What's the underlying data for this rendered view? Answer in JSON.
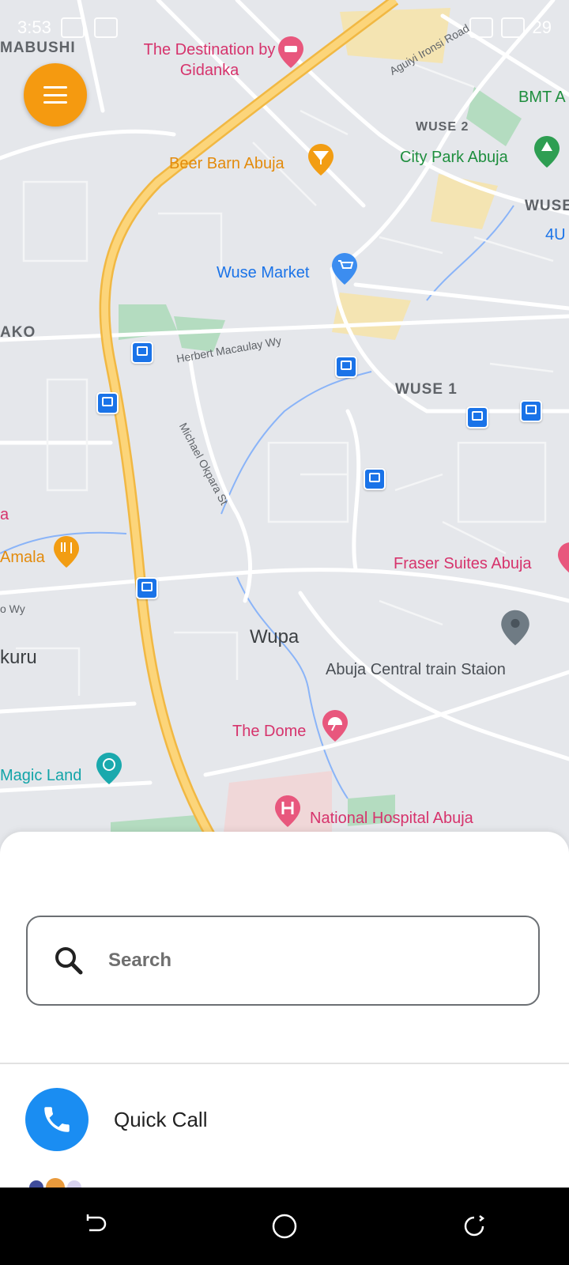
{
  "status_bar": {
    "time": "3:53",
    "battery": "29"
  },
  "map": {
    "menu_button": {
      "icon": "hamburger-menu-icon"
    },
    "district_labels": [
      "MABUSHI",
      "WUSE 2",
      "AKO",
      "WUSE 1",
      "WUSE",
      "BMT A",
      "4U"
    ],
    "area_labels": [
      "Wupa",
      "kuru"
    ],
    "street_labels": [
      "Aguiyi Ironsi Road",
      "Herbert Macaulay Wy",
      "Michael Okpara St",
      "o Wy"
    ],
    "places": [
      {
        "name": "The Destination by Gidanka",
        "icon": "hotel-icon",
        "color": "#d6336c"
      },
      {
        "name": "Beer Barn Abuja",
        "icon": "cocktail-bar-icon",
        "color": "#e38b0c"
      },
      {
        "name": "City Park Abuja",
        "icon": "park-tree-icon",
        "color": "#1e8e3e"
      },
      {
        "name": "Wuse Market",
        "icon": "shopping-cart-icon",
        "color": "#1a73e8"
      },
      {
        "name": "Amala",
        "icon": "restaurant-icon",
        "color": "#e38b0c"
      },
      {
        "name": "Fraser Suites Abuja",
        "icon": "hotel-icon",
        "color": "#d6336c"
      },
      {
        "name": "Abuja Central train Staion",
        "icon": "map-pin-icon",
        "color": "#4a4f55"
      },
      {
        "name": "The Dome",
        "icon": "beach-umbrella-icon",
        "color": "#d6336c"
      },
      {
        "name": "Magic Land",
        "icon": "amusement-park-icon",
        "color": "#12a4a8"
      },
      {
        "name": "National Hospital Abuja",
        "icon": "hospital-icon",
        "color": "#d6336c"
      },
      {
        "name": "a",
        "icon": "",
        "color": "#d6336c"
      }
    ]
  },
  "bottom_sheet": {
    "search": {
      "placeholder": "Search",
      "value": ""
    },
    "quick_call": {
      "label": "Quick Call",
      "icon": "phone-icon"
    }
  },
  "nav_bar": {
    "buttons": [
      "back-icon",
      "home-icon",
      "recents-icon"
    ]
  }
}
